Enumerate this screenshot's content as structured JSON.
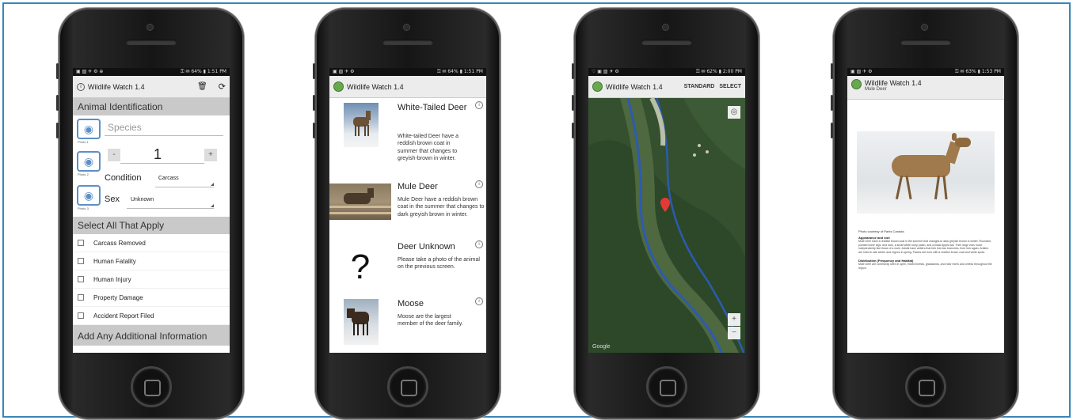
{
  "colors": {
    "frame": "#3a86b8",
    "photo_button": "#5b8fc9",
    "section": "#c9c9c9"
  },
  "screen1": {
    "status_left": "▣ ▨ ✈ ⚙ ⊕",
    "status_right": "⚿ ✉ 64% ▮ 1:51 PM",
    "title": "Wildlife Watch 1.4",
    "section_identification": "Animal Identification",
    "species_placeholder": "Species",
    "photo1": "Photo 1",
    "photo2": "Photo 2",
    "photo3": "Photo 3",
    "minus": "-",
    "count": "1",
    "plus": "+",
    "condition_label": "Condition",
    "condition_value": "Carcass",
    "sex_label": "Sex",
    "sex_value": "Unknown",
    "section_apply": "Select All That Apply",
    "checks": [
      "Carcass Removed",
      "Human Fatality",
      "Human Injury",
      "Property Damage",
      "Accident Report Filed"
    ],
    "section_additional": "Add Any Additional Information"
  },
  "screen2": {
    "status_left": "▣ ▨ ✈ ⚙",
    "status_right": "⚿ ✉ 64% ▮ 1:51 PM",
    "title": "Wildlife Watch 1.4",
    "items": [
      {
        "name": "White-Tailed Deer",
        "desc": "White-tailed Deer have a reddish brown coat in summer that changes to greyish-brown in winter."
      },
      {
        "name": "Mule Deer",
        "desc": "Mule Deer have a reddish brown coat in the summer that changes to dark greyish brown in winter."
      },
      {
        "name": "Deer Unknown",
        "desc": "Please take a photo of the animal on the previous screen."
      },
      {
        "name": "Moose",
        "desc": "Moose are the largest member of the deer family."
      }
    ],
    "unknown_glyph": "?"
  },
  "screen3": {
    "status_left": "♡ ▣ ▨ ✈ ⚙",
    "status_right": "⚿ ✉ 62% ▮ 2:00 PM",
    "title": "Wildlife Watch 1.4",
    "standard": "STANDARD",
    "select": "SELECT",
    "zoom_in": "+",
    "zoom_out": "−",
    "locate": "◎",
    "google": "Google"
  },
  "screen4": {
    "status_left": "▣ ▨ ✈ ⚙",
    "status_right": "⚿ ✉ 63% ▮ 1:53 PM",
    "title": "Wildlife Watch 1.4",
    "subtitle": "Mule Deer",
    "caption": "Photo courtesy of Parks Canada",
    "appearance_head": "Appearance and size",
    "appearance_text": "Mule Deer have a reddish brown coat in the summer that changes to dark greyish brown in winter. Rounded, pointed lower legs, and ears, a small white rump patch, and a black-tipped tail. Their large ears move independently like those of a mule. Adults have antlers that fork into two branches, then fork again. Antlers are shed in late winter and regrow in spring. Fawns are born with a reddish brown coat and white spots.",
    "distribution_head": "Distribution (Frequency and Habitat)",
    "distribution_text": "Mule Deer are commonly seen in open, mixed forests, grasslands, and near rivers and creeks throughout the region."
  }
}
